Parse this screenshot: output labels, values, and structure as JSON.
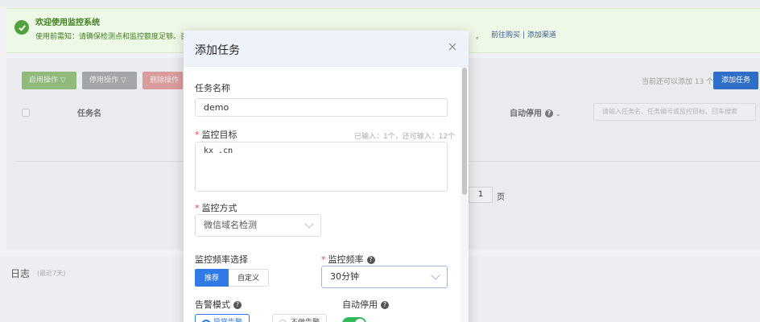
{
  "notice": {
    "title": "欢迎使用监控系统",
    "text": "使用前需知：请确保检测点和监控额度足够。否则",
    "text_tail": "。",
    "link_buy": "前往购买",
    "link_sep": "|",
    "link_channel": "添加渠道"
  },
  "toolbar": {
    "enable_label": "启用操作 ▽",
    "disable_label": "停用操作 ▽",
    "delete_label": "删除操作",
    "quota_text": "当前还可以添加 13 个",
    "add_task_label": "添加任务"
  },
  "table": {
    "col_taskname": "任务名",
    "col_autostop": "自动停用",
    "search_placeholder": "请输入任务名、任务编号或监控目标、回车搜索"
  },
  "pagination": {
    "current": "1",
    "unit": "页"
  },
  "log": {
    "title": "日志",
    "subtitle": "(最近7天)"
  },
  "modal": {
    "title": "添加任务",
    "task_name_label": "任务名称",
    "task_name_value": "demo",
    "target_label": "监控目标",
    "target_counter": "已输入：1个，还可输入：12个",
    "target_value": "kx   .cn",
    "method_label": "监控方式",
    "method_value": "微信域名检测",
    "freq_select_label": "监控频率选择",
    "freq_option_recommend": "推荐",
    "freq_option_custom": "自定义",
    "freq_label": "监控频率",
    "freq_value": "30分钟",
    "alert_mode_label": "告警模式",
    "alert_option_a": "异常告警",
    "alert_option_b": "不做告警",
    "auto_stop_label": "自动停用"
  },
  "colors": {
    "primary": "#2f7ae5",
    "success": "#33b95a",
    "required": "#e5484d"
  }
}
